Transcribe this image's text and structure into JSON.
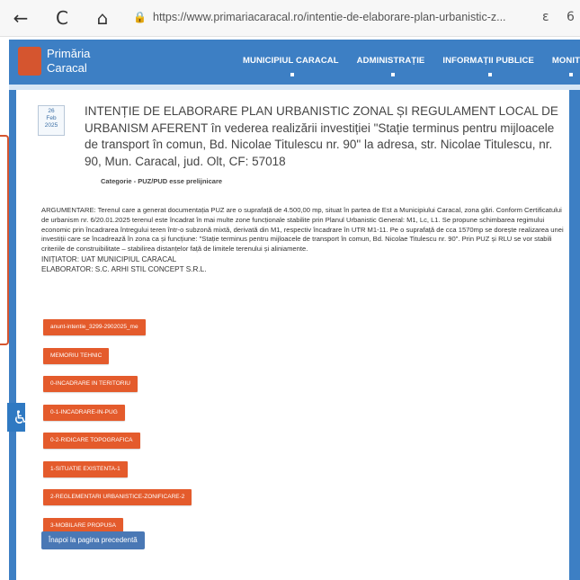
{
  "browser": {
    "url": "https://www.primariacaracal.ro/intentie-de-elaborare-plan-urbanistic-z...",
    "back_icon": "←",
    "reload_icon": "C",
    "home_icon": "⌂",
    "lock_icon": "🔒",
    "read_icon": "ε",
    "extra_icon": "6"
  },
  "site": {
    "logo_line1": "Primăria",
    "logo_line2": "Caracal",
    "menu": [
      "MUNICIPIUL CARACAL",
      "ADMINISTRAȚIE",
      "INFORMAȚII PUBLICE",
      "MONITO"
    ],
    "accent": "#3d7fc4",
    "orange": "#e45b2c"
  },
  "post": {
    "date_day": "26",
    "date_month": "Feb",
    "date_year": "2025",
    "title": "INTENȚIE DE ELABORARE PLAN URBANISTIC ZONAL ȘI REGULAMENT LOCAL DE URBANISM AFERENT în vederea realizării investiției \"Stație terminus pentru mijloacele de transport în comun, Bd. Nicolae Titulescu nr. 90\" la adresa, str. Nicolae Titulescu, nr. 90, Mun. Caracal, jud. Olt, CF: 57018",
    "category": "Categorie - PUZ/PUD esse prelijnicare",
    "argument": "ARGUMENTARE: Terenul care a generat documentația PUZ are o suprafață de 4.500,00 mp, situat în partea de Est a Municipiului Caracal, zona gări. Conform Certificatului de urbanism nr. 6/20.01.2025 terenul este încadrat în mai multe zone funcționale stabilite prin Planul Urbanistic General: M1, Lc, L1. Se propune schimbarea regimului economic prin încadrarea întregului teren într-o subzonă mixtă, derivată din M1, respectiv încadrare în UTR M1-11. Pe o suprafață de cca 1570mp se dorește realizarea unei investiții care se încadrează în zona ca și funcțiune: \"Stație terminus pentru mijloacele de transport în comun, Bd. Nicolae Titulescu nr. 90\". Prin PUZ și RLU se vor stabili criteriile de construibilitate – stabilirea distanțelor față de limitele terenului și aliniamente.",
    "initiator": "INIȚIATOR: UAT MUNICIPIUL CARACAL",
    "elaborator": "ELABORATOR: S.C. ARHI STIL CONCEPT S.R.L.",
    "files": [
      "anunt-intentie_3299-2902025_me",
      "MEMORIU TEHNIC",
      "0-INCADRARE IN TERITORIU",
      "0-1-INCADRARE-IN-PUG",
      "0-2-RIDICARE TOPOGRAFICA",
      "1-SITUATIE EXISTENTA-1",
      "2-REGLEMENTARI URBANISTICE-ZONIFICARE-2",
      "3-MOBILARE PROPUSA"
    ],
    "back_label": "Înapoi la pagina precedentă"
  }
}
